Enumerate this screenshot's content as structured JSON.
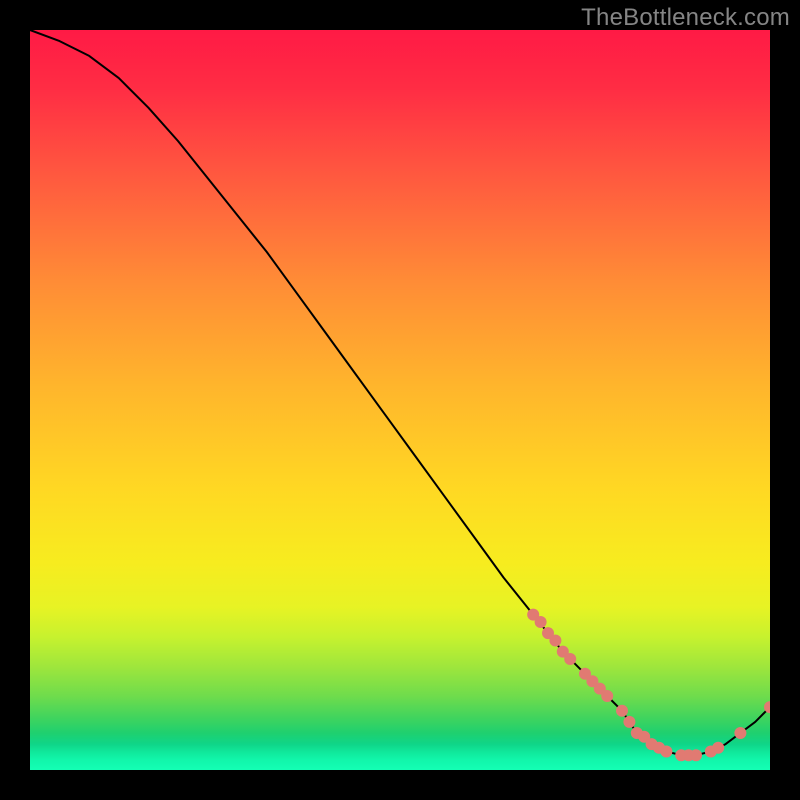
{
  "watermark": "TheBottleneck.com",
  "colors": {
    "page_bg": "#000000",
    "watermark": "#858585",
    "curve": "#000000",
    "marker": "#e17a72",
    "gradient_top": "#ff1a45",
    "gradient_bottom": "#14ffb4"
  },
  "chart_data": {
    "type": "line",
    "title": "",
    "xlabel": "",
    "ylabel": "",
    "xlim": [
      0,
      100
    ],
    "ylim": [
      0,
      100
    ],
    "grid": false,
    "legend": "none",
    "notes": "Axes have no visible tick labels; values are estimated from pixel positions on a 0–100 normalized scale. y represents bottleneck percentage (red/top = high, green/bottom = low). Curve descends from top-left, bottoms out near x≈82, then rises slightly.",
    "series": [
      {
        "name": "bottleneck-curve",
        "x": [
          0,
          4,
          8,
          12,
          16,
          20,
          24,
          28,
          32,
          36,
          40,
          44,
          48,
          52,
          56,
          60,
          64,
          68,
          72,
          74,
          76,
          78,
          80,
          82,
          84,
          86,
          88,
          90,
          92,
          94,
          96,
          98,
          100
        ],
        "y": [
          100,
          98.5,
          96.5,
          93.5,
          89.5,
          85,
          80,
          75,
          70,
          64.5,
          59,
          53.5,
          48,
          42.5,
          37,
          31.5,
          26,
          21,
          16,
          14,
          12,
          10,
          8,
          5,
          3.5,
          2.5,
          2,
          2,
          2.5,
          3.5,
          5,
          6.5,
          8.5
        ]
      }
    ],
    "markers": {
      "name": "highlighted-points",
      "color": "#e17a72",
      "x": [
        68,
        69,
        70,
        71,
        72,
        73,
        75,
        76,
        77,
        78,
        80,
        81,
        82,
        83,
        84,
        85,
        86,
        88,
        89,
        90,
        92,
        93,
        96,
        100
      ],
      "y": [
        21,
        20,
        18.5,
        17.5,
        16,
        15,
        13,
        12,
        11,
        10,
        8,
        6.5,
        5,
        4.5,
        3.5,
        3,
        2.5,
        2,
        2,
        2,
        2.5,
        3,
        5,
        8.5
      ]
    }
  }
}
